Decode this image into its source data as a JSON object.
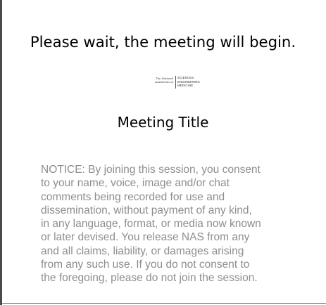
{
  "headline": "Please wait, the meeting will begin.",
  "logo": {
    "left_lines": [
      "The National",
      "Academies of"
    ],
    "right_lines": [
      "SCIENCES",
      "ENGINEERING",
      "MEDICINE"
    ]
  },
  "meeting_title": "Meeting Title",
  "notice_lines": [
    "NOTICE: By joining this session, you consent",
    "to your name, voice, image and/or chat",
    "comments being recorded for use and",
    "dissemination, without payment of any kind,",
    "in any language, format, or media now known",
    "or later devised. You release NAS from any",
    "and all claims, liability, or damages arising",
    "from any such use. If you do not consent to",
    "the foregoing, please do not join the session."
  ],
  "colors": {
    "background": "#ffffff",
    "text": "#000000",
    "notice_text": "#8e8e8e",
    "border": "#4a4a4a"
  }
}
